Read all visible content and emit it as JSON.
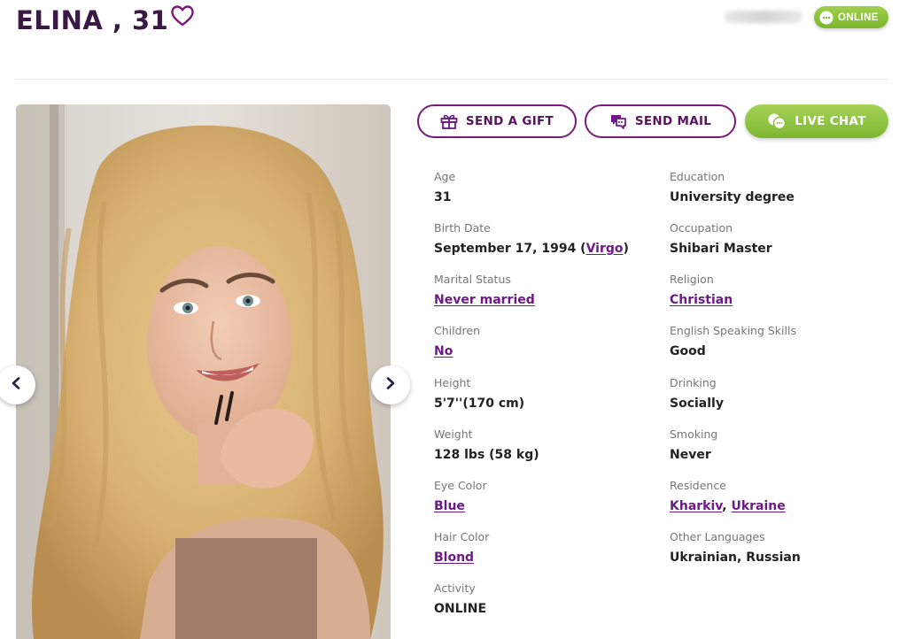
{
  "header": {
    "name_age": "ELINA , 31",
    "status": "ONLINE"
  },
  "actions": {
    "gift": "SEND A GIFT",
    "mail": "SEND MAIL",
    "chat": "LIVE CHAT"
  },
  "left_column": [
    {
      "label": "Age",
      "value": "31"
    },
    {
      "label": "Birth Date",
      "value": "September 17, 1994 (",
      "link": "Virgo",
      "suffix": ")"
    },
    {
      "label": "Marital Status",
      "link": "Never married"
    },
    {
      "label": "Children",
      "link": "No"
    },
    {
      "label": "Height",
      "value": "5'7''(170 cm)"
    },
    {
      "label": "Weight",
      "value": "128 lbs (58 kg)"
    },
    {
      "label": "Eye Color",
      "link": "Blue"
    },
    {
      "label": "Hair Color",
      "link": "Blond"
    },
    {
      "label": "Activity",
      "value": "ONLINE"
    }
  ],
  "right_column": [
    {
      "label": "Education",
      "value": "University degree"
    },
    {
      "label": "Occupation",
      "value": "Shibari Master"
    },
    {
      "label": "Religion",
      "link": "Christian"
    },
    {
      "label": "English Speaking Skills",
      "value": "Good"
    },
    {
      "label": "Drinking",
      "value": "Socially"
    },
    {
      "label": "Smoking",
      "value": "Never"
    },
    {
      "label": "Residence",
      "link": "Kharkiv",
      "sep": ", ",
      "link2": "Ukraine"
    },
    {
      "label": "Other Languages",
      "value": "Ukrainian, Russian"
    }
  ],
  "colors": {
    "brand_purple": "#6b1a86",
    "online_green": "#7cb72d",
    "name_color": "#3a1a45"
  },
  "icons": {
    "favorite": "heart-outline-icon",
    "gift": "gift-icon",
    "mail": "mail-chat-icon",
    "chat": "chat-bubbles-icon",
    "prev": "chevron-left-icon",
    "next": "chevron-right-icon"
  }
}
